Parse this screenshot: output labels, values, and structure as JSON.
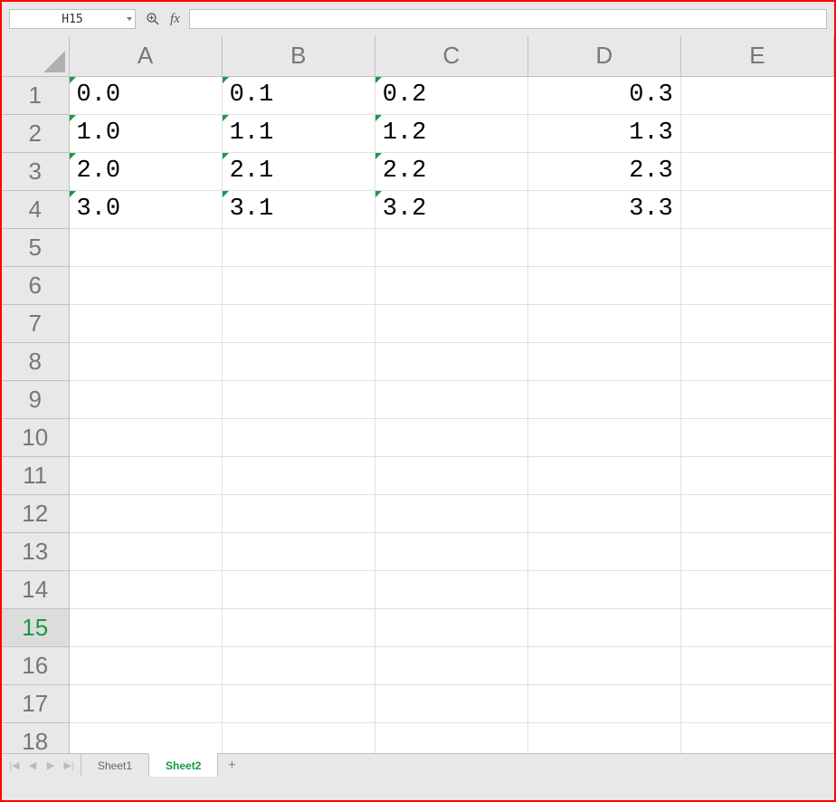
{
  "formula_bar": {
    "cell_ref": "H15",
    "fx_label": "fx",
    "formula_value": ""
  },
  "columns": [
    "A",
    "B",
    "C",
    "D",
    "E"
  ],
  "rows": [
    "1",
    "2",
    "3",
    "4",
    "5",
    "6",
    "7",
    "8",
    "9",
    "10",
    "11",
    "12",
    "13",
    "14",
    "15",
    "16",
    "17",
    "18"
  ],
  "active_row": "15",
  "cells": {
    "r1": {
      "A": "0.0",
      "B": "0.1",
      "C": "0.2",
      "D": "0.3"
    },
    "r2": {
      "A": "1.0",
      "B": "1.1",
      "C": "1.2",
      "D": "1.3"
    },
    "r3": {
      "A": "2.0",
      "B": "2.1",
      "C": "2.2",
      "D": "2.3"
    },
    "r4": {
      "A": "3.0",
      "B": "3.1",
      "C": "3.2",
      "D": "3.3"
    }
  },
  "text_stored_as_number_cols": [
    "A",
    "B",
    "C"
  ],
  "right_aligned_cols": [
    "D"
  ],
  "tabs": {
    "nav": {
      "first": "|◀",
      "prev": "◀",
      "next": "▶",
      "last": "▶|"
    },
    "items": [
      {
        "label": "Sheet1",
        "active": false
      },
      {
        "label": "Sheet2",
        "active": true
      }
    ],
    "add": "+"
  }
}
